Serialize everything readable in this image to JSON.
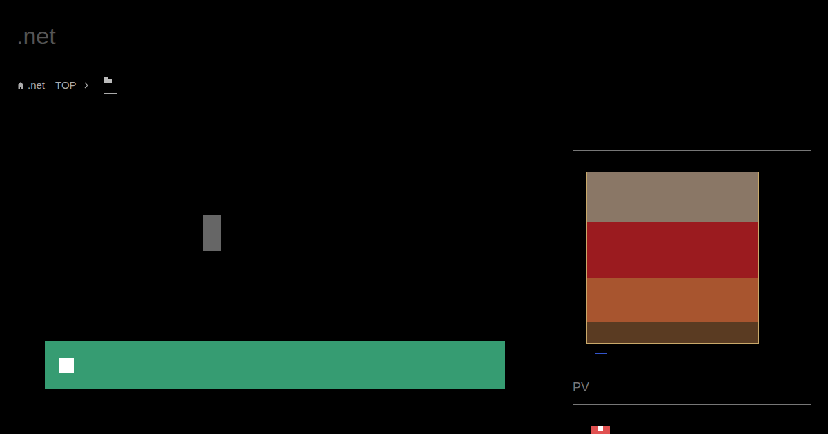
{
  "site": {
    "title": ".net"
  },
  "breadcrumb": [
    {
      "label": ".net　TOP"
    }
  ],
  "sidebar": {
    "section": "PV"
  }
}
